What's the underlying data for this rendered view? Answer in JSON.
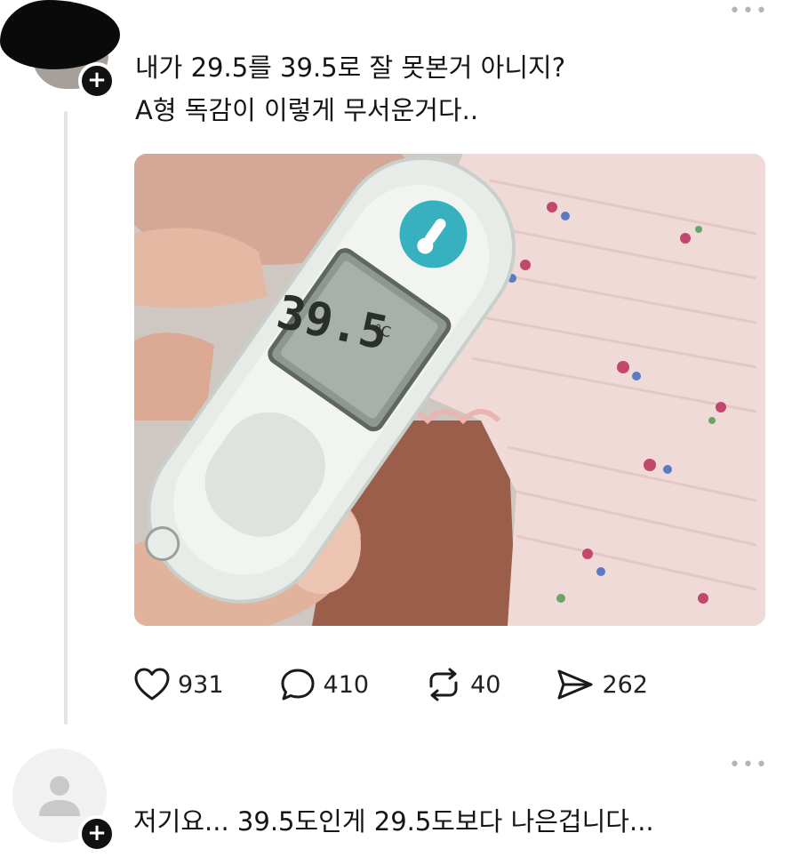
{
  "post1": {
    "line1": "내가 29.5를 39.5로 잘 못본거 아니지?",
    "line2": "A형 독감이 이렇게 무서운거다..",
    "thermometer_reading": "39.5",
    "thermometer_unit": "°C",
    "actions": {
      "likes": "931",
      "comments": "410",
      "reposts": "40",
      "shares": "262"
    }
  },
  "post2": {
    "text": "저기요... 39.5도인게 29.5도보다 나은겁니다..."
  },
  "icons": {
    "follow": "plus-icon",
    "more": "more-horizontal-icon",
    "like": "heart-icon",
    "comment": "comment-bubble-icon",
    "repost": "repost-arrows-icon",
    "share": "send-icon",
    "default_avatar": "user-silhouette-icon"
  }
}
